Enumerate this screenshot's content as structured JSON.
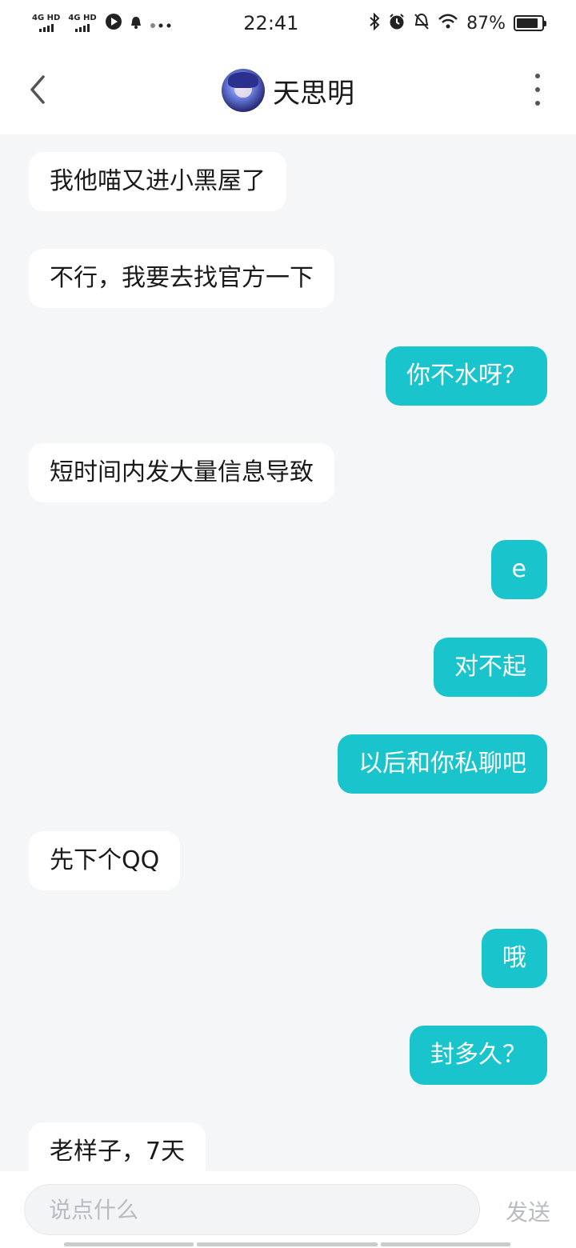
{
  "status_bar": {
    "signal1_label": "4G HD",
    "signal2_label": "4G HD",
    "time": "22:41",
    "battery": "87%",
    "battery_level": 0.87,
    "icons": [
      "signal-icon",
      "signal-icon",
      "music-app-icon",
      "notification-icon",
      "more-dots-icon",
      "bluetooth-icon",
      "alarm-icon",
      "mute-icon",
      "wifi-icon",
      "battery-icon"
    ]
  },
  "header": {
    "title": "天思明",
    "back_icon": "chevron-left-icon",
    "more_icon": "more-vertical-icon"
  },
  "messages": [
    {
      "side": "in",
      "text": "我他喵又进小黑屋了"
    },
    {
      "side": "in",
      "text": "不行，我要去找官方一下"
    },
    {
      "side": "out",
      "text": "你不水呀？"
    },
    {
      "side": "in",
      "text": "短时间内发大量信息导致"
    },
    {
      "side": "out",
      "text": "e"
    },
    {
      "side": "out",
      "text": "对不起"
    },
    {
      "side": "out",
      "text": "以后和你私聊吧"
    },
    {
      "side": "in",
      "text": "先下个QQ"
    },
    {
      "side": "out",
      "text": "哦"
    },
    {
      "side": "out",
      "text": "封多久？"
    },
    {
      "side": "in",
      "text": "老样子，7天"
    }
  ],
  "input": {
    "placeholder": "说点什么",
    "value": "",
    "send_label": "发送"
  },
  "colors": {
    "accent": "#19c4cc",
    "background": "#f4f6f8",
    "bubble_in": "#ffffff"
  }
}
